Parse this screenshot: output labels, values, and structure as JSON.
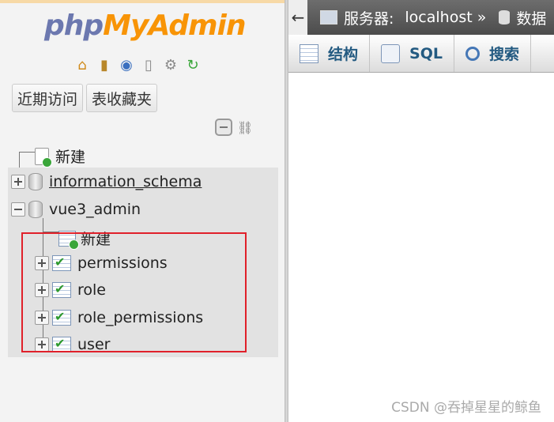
{
  "nav": {
    "logo_part1": "php",
    "logo_part2": "MyAdmin",
    "icons": [
      "home-icon",
      "exit-icon",
      "help-icon",
      "docs-icon",
      "settings-icon",
      "reload-icon"
    ],
    "recent_button": "近期访问",
    "favorites_button": "表收藏夹",
    "tree": {
      "new_root": "新建",
      "databases": [
        {
          "name": "information_schema",
          "expanded": false
        },
        {
          "name": "vue3_admin",
          "expanded": true
        }
      ],
      "new_table": "新建",
      "tables": [
        "permissions",
        "role",
        "role_permissions",
        "user"
      ]
    }
  },
  "topbar": {
    "back_glyph": "←",
    "server_label": "服务器:",
    "server_value": "localhost",
    "separator": "»",
    "db_label": "数据"
  },
  "tabs": [
    {
      "label": "结构",
      "icon": "structure-icon"
    },
    {
      "label": "SQL",
      "icon": "sql-icon"
    },
    {
      "label": "搜索",
      "icon": "search-icon"
    }
  ],
  "watermark": "CSDN @吞掉星星的鲸鱼",
  "colors": {
    "highlight_border": "#e0202a",
    "tab_text": "#235a81"
  }
}
